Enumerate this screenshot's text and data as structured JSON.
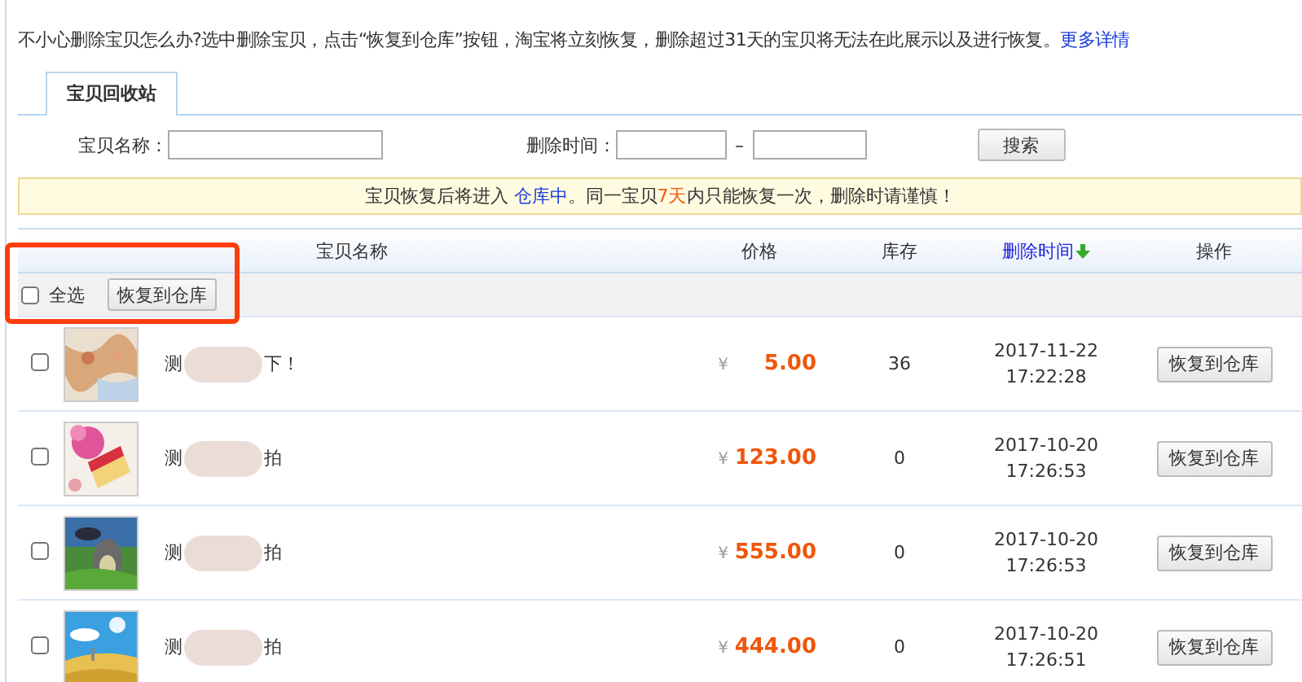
{
  "intro": {
    "text": "不小心删除宝贝怎么办?选中删除宝贝，点击“恢复到仓库”按钮，淘宝将立刻恢复，删除超过31天的宝贝将无法在此展示以及进行恢复。",
    "link": "更多详情"
  },
  "tabs": [
    {
      "label": "宝贝回收站",
      "selected": true
    }
  ],
  "search": {
    "name_label": "宝贝名称：",
    "time_label": "删除时间：",
    "range_sep": "–",
    "button": "搜索"
  },
  "notice": {
    "before": "宝贝恢复后将进入 ",
    "link": "仓库中",
    "middle": "。同一宝贝",
    "highlight": "7天",
    "after": "内只能恢复一次，删除时请谨慎！"
  },
  "table": {
    "columns": [
      {
        "label": "宝贝名称",
        "sorted": false
      },
      {
        "label": "价格",
        "sorted": false
      },
      {
        "label": "库存",
        "sorted": false
      },
      {
        "label": "删除时间",
        "sorted": true
      },
      {
        "label": "操作",
        "sorted": false
      }
    ],
    "select_all": {
      "label": "全选",
      "checked": false
    },
    "bulk_button": "恢复到仓库",
    "rows": [
      {
        "checked": false,
        "name_start": "测",
        "name_end": "下！",
        "currency": "¥",
        "price": "5.00",
        "stock": "36",
        "date": "2017-11-22",
        "time": "17:22:28",
        "action": "恢复到仓库"
      },
      {
        "checked": false,
        "name_start": "测",
        "name_end": "拍",
        "currency": "¥",
        "price": "123.00",
        "stock": "0",
        "date": "2017-10-20",
        "time": "17:26:53",
        "action": "恢复到仓库"
      },
      {
        "checked": false,
        "name_start": "测",
        "name_end": "拍",
        "currency": "¥",
        "price": "555.00",
        "stock": "0",
        "date": "2017-10-20",
        "time": "17:26:53",
        "action": "恢复到仓库"
      },
      {
        "checked": false,
        "name_start": "测",
        "name_end": "拍",
        "currency": "¥",
        "price": "444.00",
        "stock": "0",
        "date": "2017-10-20",
        "time": "17:26:51",
        "action": "恢复到仓库"
      }
    ]
  }
}
